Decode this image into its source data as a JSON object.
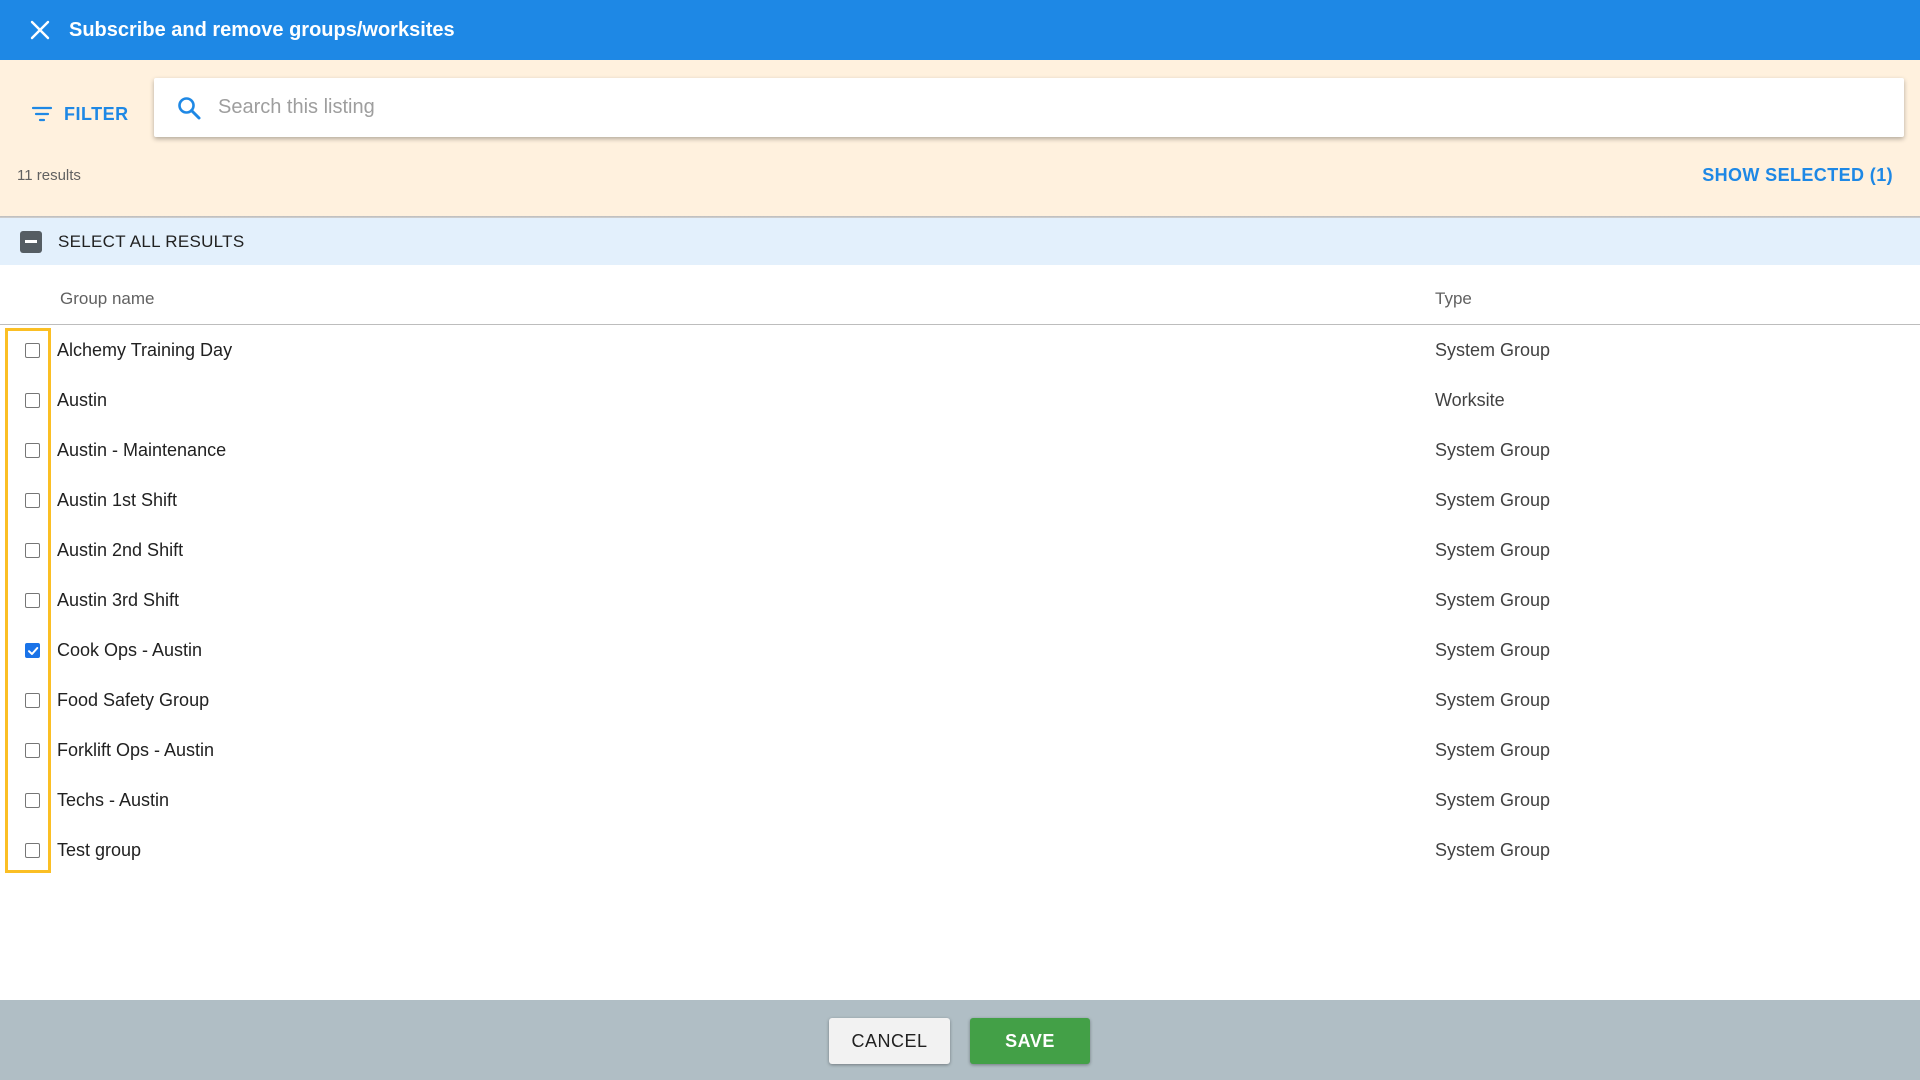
{
  "header": {
    "title": "Subscribe and remove groups/worksites",
    "close_icon": "close-icon",
    "background_color": "#1e88e5"
  },
  "filter": {
    "label": "FILTER",
    "icon": "filter-icon"
  },
  "search": {
    "placeholder": "Search this listing",
    "value": "",
    "icon": "search-icon"
  },
  "results": {
    "count_text": "11 results",
    "show_selected_label": "SHOW SELECTED (1)"
  },
  "select_all": {
    "label": "SELECT ALL RESULTS",
    "state": "indeterminate"
  },
  "table": {
    "columns": [
      "Group name",
      "Type"
    ],
    "rows": [
      {
        "name": "Alchemy Training Day",
        "type": "System Group",
        "checked": false
      },
      {
        "name": "Austin",
        "type": "Worksite",
        "checked": false
      },
      {
        "name": "Austin - Maintenance",
        "type": "System Group",
        "checked": false
      },
      {
        "name": "Austin 1st Shift",
        "type": "System Group",
        "checked": false
      },
      {
        "name": "Austin 2nd Shift",
        "type": "System Group",
        "checked": false
      },
      {
        "name": "Austin 3rd Shift",
        "type": "System Group",
        "checked": false
      },
      {
        "name": "Cook Ops - Austin",
        "type": "System Group",
        "checked": true
      },
      {
        "name": "Food Safety Group",
        "type": "System Group",
        "checked": false
      },
      {
        "name": "Forklift Ops - Austin",
        "type": "System Group",
        "checked": false
      },
      {
        "name": "Techs - Austin",
        "type": "System Group",
        "checked": false
      },
      {
        "name": "Test group",
        "type": "System Group",
        "checked": false
      }
    ]
  },
  "footer": {
    "cancel_label": "CANCEL",
    "save_label": "SAVE",
    "save_color": "#43a047"
  },
  "colors": {
    "accent": "#1e88e5",
    "filter_bar_bg": "#fff1de",
    "select_all_bg": "#e3f0fc",
    "highlight_border": "#fbbf24",
    "footer_bg": "#b0bec5"
  }
}
